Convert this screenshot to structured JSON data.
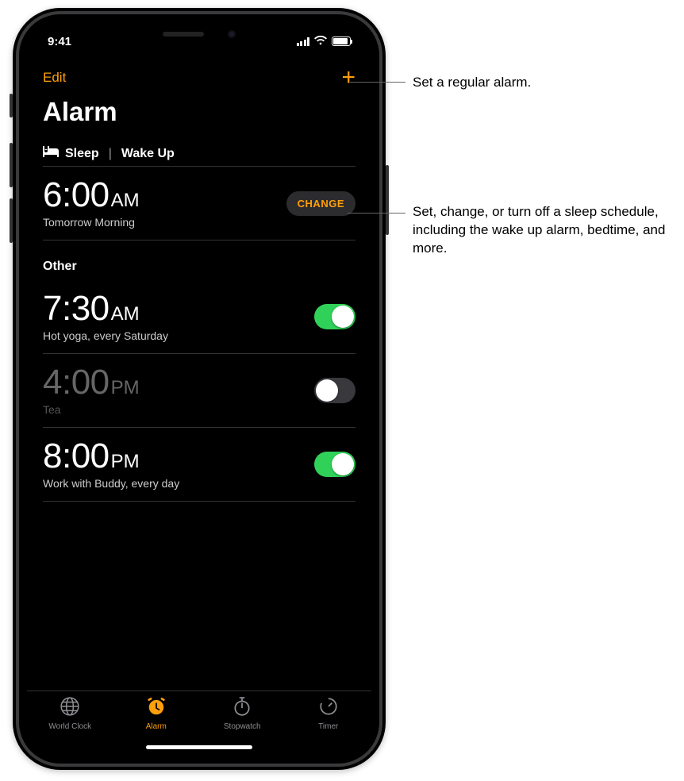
{
  "status": {
    "time": "9:41"
  },
  "nav": {
    "edit": "Edit"
  },
  "title": "Alarm",
  "sleep": {
    "icon_name": "bed-icon",
    "header_left": "Sleep",
    "header_right": "Wake Up",
    "time": "6:00",
    "ampm": "AM",
    "sub": "Tomorrow Morning",
    "change": "CHANGE"
  },
  "other_header": "Other",
  "alarms": [
    {
      "time": "7:30",
      "ampm": "AM",
      "sub": "Hot yoga, every Saturday",
      "on": true
    },
    {
      "time": "4:00",
      "ampm": "PM",
      "sub": "Tea",
      "on": false
    },
    {
      "time": "8:00",
      "ampm": "PM",
      "sub": "Work with Buddy, every day",
      "on": true
    }
  ],
  "tabs": [
    {
      "label": "World Clock"
    },
    {
      "label": "Alarm"
    },
    {
      "label": "Stopwatch"
    },
    {
      "label": "Timer"
    }
  ],
  "callouts": {
    "add": "Set a regular alarm.",
    "change": "Set, change, or turn off a sleep schedule, including the wake up alarm, bedtime, and more."
  }
}
